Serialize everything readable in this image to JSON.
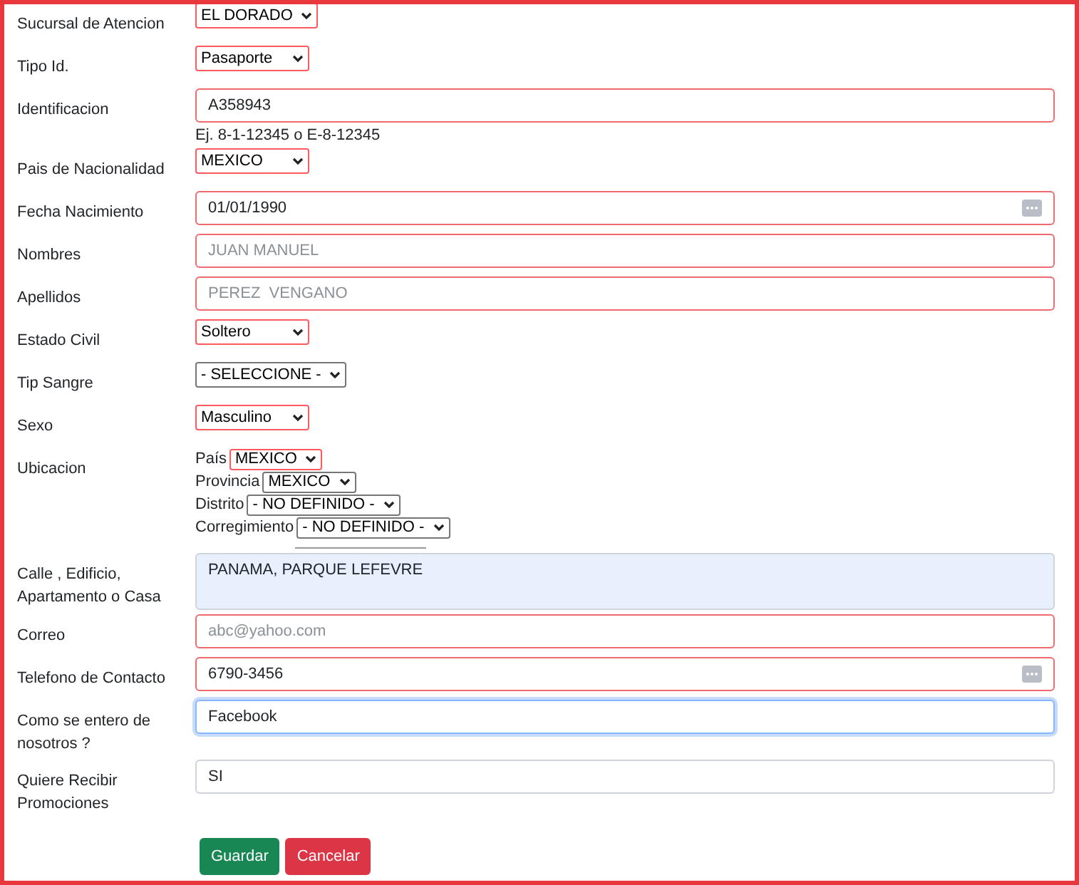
{
  "fields": [
    {
      "kind": "select",
      "label": "Sucursal de Atencion",
      "value": "EL DORADO",
      "invalid": true,
      "focused": false
    },
    {
      "kind": "select",
      "label": "Tipo Id.",
      "value": "Pasaporte",
      "invalid": true,
      "focused": false
    },
    {
      "kind": "input",
      "label": "Identificacion",
      "value": "A358943",
      "hint": "Ej. 8-1-12345 o E-8-12345",
      "invalid": true,
      "focused": false
    },
    {
      "kind": "select",
      "label": "Pais de Nacionalidad",
      "value": "MEXICO",
      "invalid": true,
      "focused": false
    },
    {
      "kind": "picker",
      "label": "Fecha Nacimiento",
      "value": "01/01/1990",
      "invalid": true,
      "focused": false
    },
    {
      "kind": "input",
      "label": "Nombres",
      "placeholder": "JUAN MANUEL",
      "invalid": true,
      "focused": false
    },
    {
      "kind": "input",
      "label": "Apellidos",
      "placeholder": "PEREZ  VENGANO",
      "invalid": true,
      "focused": false
    },
    {
      "kind": "select",
      "label": "Estado Civil",
      "value": "Soltero",
      "invalid": true,
      "focused": false
    },
    {
      "kind": "select",
      "label": "Tip Sangre",
      "value": "- SELECCIONE -",
      "invalid": false,
      "focused": false
    },
    {
      "kind": "select",
      "label": "Sexo",
      "value": "Masculino",
      "invalid": true,
      "focused": false
    },
    {
      "kind": "location",
      "label": "Ubicacion",
      "selects": [
        {
          "label": "País",
          "value": "MEXICO",
          "invalid": true
        },
        {
          "label": "Provincia",
          "value": "MEXICO",
          "invalid": false
        },
        {
          "label": "Distrito",
          "value": "- NO DEFINIDO -",
          "invalid": false
        },
        {
          "label": "Corregimiento",
          "value": "- NO DEFINIDO -",
          "invalid": false
        }
      ]
    },
    {
      "kind": "textarea",
      "label": "Calle , Edificio, Apartamento o Casa",
      "value": "PANAMA, PARQUE LEFEVRE",
      "invalid": false,
      "focused": false
    },
    {
      "kind": "input",
      "label": "Correo",
      "placeholder": "abc@yahoo.com",
      "invalid": true,
      "focused": false
    },
    {
      "kind": "picker",
      "label": "Telefono de Contacto",
      "value": "6790-3456",
      "invalid": true,
      "focused": false
    },
    {
      "kind": "input",
      "label": "Como se entero de nosotros ?",
      "value": "Facebook",
      "invalid": false,
      "focused": true
    },
    {
      "kind": "input",
      "label": "Quiere Recibir Promociones",
      "value": "SI",
      "invalid": false,
      "focused": false
    }
  ],
  "buttons": [
    {
      "label": "Guardar",
      "kind": "save"
    },
    {
      "label": "Cancelar",
      "kind": "cancel"
    }
  ]
}
